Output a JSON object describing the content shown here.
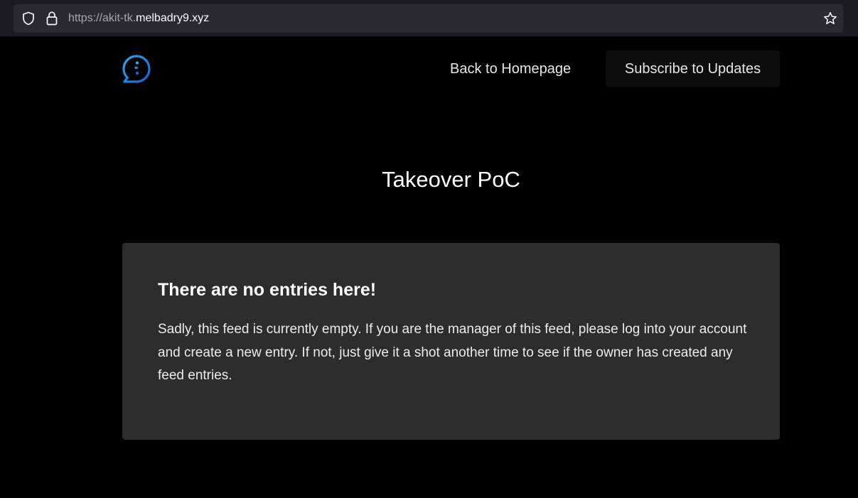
{
  "browser": {
    "url_prefix": "https://akit-tk.",
    "url_domain": "melbadry9.xyz",
    "icons": [
      "shield-icon",
      "lock-icon",
      "star-icon"
    ]
  },
  "header": {
    "logo_icon": "chat-bubble-logo-icon",
    "nav_home_label": "Back to Homepage",
    "nav_subscribe_label": "Subscribe to Updates"
  },
  "main": {
    "title": "Takeover PoC",
    "card": {
      "heading": "There are no entries here!",
      "body": "Sadly, this feed is currently empty. If you are the manager of this feed, please log into your account and create a new entry. If not, just give it a shot another time to see if the owner has created any feed entries."
    }
  },
  "colors": {
    "background": "#000000",
    "card": "#2d2d2d",
    "logo_gradient_start": "#2aa8f0",
    "logo_gradient_end": "#1565d8"
  }
}
